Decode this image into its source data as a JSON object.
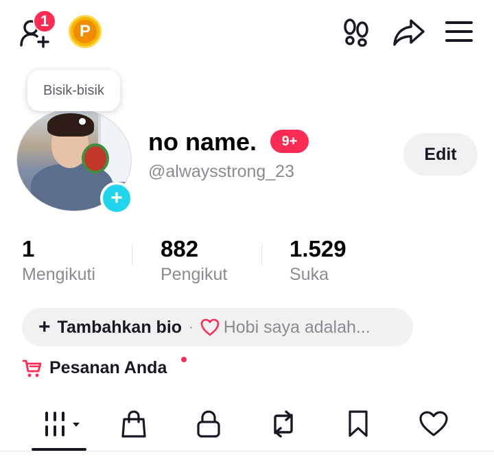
{
  "header": {
    "friend_requests_count": "1",
    "coin_letter": "P",
    "icons": [
      "add-friend-icon",
      "coins-icon",
      "footprints-icon",
      "share-icon",
      "menu-icon"
    ]
  },
  "profile": {
    "bubble_text": "Bisik-bisik",
    "name": "no name.",
    "name_badge": "9+",
    "handle": "@alwaysstrong_23",
    "edit_label": "Edit",
    "add_avatar_label": "+"
  },
  "stats": [
    {
      "value": "1",
      "label": "Mengikuti"
    },
    {
      "value": "882",
      "label": "Pengikut"
    },
    {
      "value": "1.529",
      "label": "Suka"
    }
  ],
  "bio": {
    "add_label": "Tambahkan bio",
    "separator": "·",
    "hint": "Hobi saya adalah..."
  },
  "orders": {
    "label": "Pesanan Anda"
  },
  "tabs": [
    {
      "name": "videos",
      "icon": "grid-icon",
      "active": true
    },
    {
      "name": "shop",
      "icon": "shopping-bag-icon"
    },
    {
      "name": "private",
      "icon": "lock-icon"
    },
    {
      "name": "reposts",
      "icon": "repost-icon"
    },
    {
      "name": "favorites",
      "icon": "bookmark-icon"
    },
    {
      "name": "liked",
      "icon": "heart-icon"
    }
  ],
  "colors": {
    "accent": "#fe2c55",
    "cyan": "#20d5ec",
    "coin": "#f7b500",
    "text": "#161823",
    "muted": "#8a8b91",
    "pill_bg": "#f1f1f2"
  }
}
